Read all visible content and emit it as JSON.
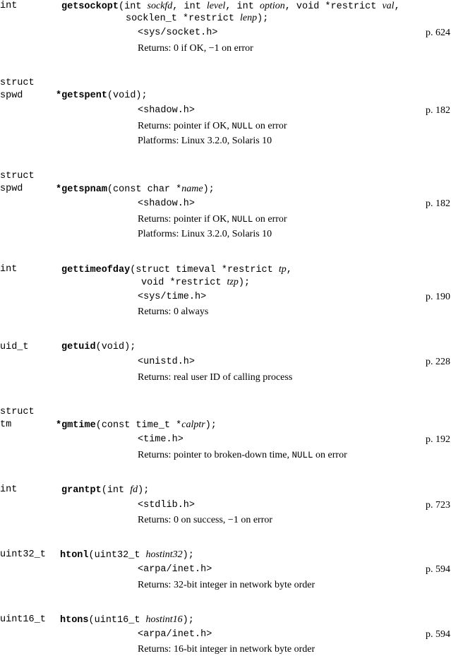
{
  "entries": [
    {
      "rtype": "int",
      "name": "getsockopt",
      "sig1_open": "(int ",
      "a1": "sockfd",
      "s1": ", int ",
      "a2": "level",
      "s2": ", int ",
      "a3": "option",
      "s3": ", void *restrict ",
      "a4": "val",
      "s4": ",",
      "sig2_pre": "socklen_t *restrict ",
      "a5": "lenp",
      "sig2_post": ");",
      "header": "<sys/socket.h>",
      "page": "p. 624",
      "returns": "Returns: 0 if OK, −1 on error"
    },
    {
      "rtype1": "struct",
      "rtype2": "spwd",
      "star": "*",
      "name": "getspent",
      "sig": "(void);",
      "header": "<shadow.h>",
      "page": "p. 182",
      "returns_pre": "Returns: pointer if OK, ",
      "returns_null": "NULL",
      "returns_post": " on error",
      "platforms": "Platforms: Linux 3.2.0, Solaris 10"
    },
    {
      "rtype1": "struct",
      "rtype2": "spwd",
      "star": "*",
      "name": "getspnam",
      "sig_pre": "(const char *",
      "a1": "name",
      "sig_post": ");",
      "header": "<shadow.h>",
      "page": "p. 182",
      "returns_pre": "Returns: pointer if OK, ",
      "returns_null": "NULL",
      "returns_post": " on error",
      "platforms": "Platforms: Linux 3.2.0, Solaris 10"
    },
    {
      "rtype": "int",
      "name": "gettimeofday",
      "sig1_pre": "(struct timeval *restrict ",
      "a1": "tp",
      "sig1_post": ",",
      "sig2_pre": "void *restrict ",
      "a2": "tzp",
      "sig2_post": ");",
      "header": "<sys/time.h>",
      "page": "p. 190",
      "returns": "Returns: 0 always"
    },
    {
      "rtype": "uid_t",
      "name": "getuid",
      "sig": "(void);",
      "header": "<unistd.h>",
      "page": "p. 228",
      "returns": "Returns: real user ID of calling process"
    },
    {
      "rtype1": "struct",
      "rtype2": "tm",
      "star": "*",
      "name": "gmtime",
      "sig_pre": "(const time_t *",
      "a1": "calptr",
      "sig_post": ");",
      "header": "<time.h>",
      "page": "p. 192",
      "returns_pre": "Returns: pointer to broken-down time, ",
      "returns_null": "NULL",
      "returns_post": " on error"
    },
    {
      "rtype": "int",
      "name": "grantpt",
      "sig_pre": "(int ",
      "a1": "fd",
      "sig_post": ");",
      "header": "<stdlib.h>",
      "page": "p. 723",
      "returns": "Returns: 0 on success, −1 on error"
    },
    {
      "rtype": "uint32_t",
      "name": "htonl",
      "sig_pre": "(uint32_t ",
      "a1": "hostint32",
      "sig_post": ");",
      "header": "<arpa/inet.h>",
      "page": "p. 594",
      "returns": "Returns: 32-bit integer in network byte order"
    },
    {
      "rtype": "uint16_t",
      "name": "htons",
      "sig_pre": "(uint16_t ",
      "a1": "hostint16",
      "sig_post": ");",
      "header": "<arpa/inet.h>",
      "page": "p. 594",
      "returns": "Returns: 16-bit integer in network byte order"
    }
  ]
}
